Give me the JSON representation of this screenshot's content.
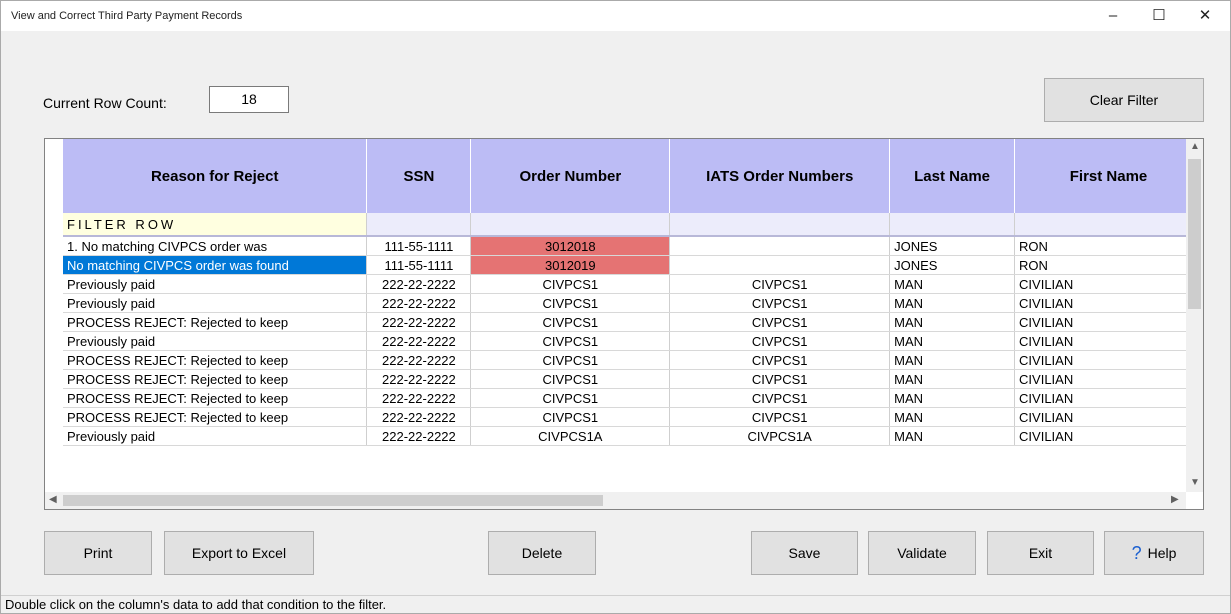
{
  "window": {
    "title": "View and Correct Third Party Payment Records",
    "minimize": "–",
    "maximize": "☐",
    "close": "✕"
  },
  "row_count": {
    "label": "Current Row Count:",
    "value": "18"
  },
  "buttons": {
    "clear_filter": "Clear Filter",
    "print": "Print",
    "export": "Export to Excel",
    "delete": "Delete",
    "save": "Save",
    "validate": "Validate",
    "exit": "Exit",
    "help": "Help"
  },
  "grid": {
    "columns": [
      "Reason for Reject",
      "SSN",
      "Order Number",
      "IATS Order Numbers",
      "Last Name",
      "First Name"
    ],
    "filter_label": "FILTER ROW",
    "rows": [
      [
        "1. No matching CIVPCS order was",
        "111-55-1111",
        "3012018",
        "",
        "JONES",
        "RON"
      ],
      [
        "No matching CIVPCS order was found",
        "111-55-1111",
        "3012019",
        "",
        "JONES",
        "RON"
      ],
      [
        "Previously paid",
        "222-22-2222",
        "CIVPCS1",
        "CIVPCS1",
        "MAN",
        "CIVILIAN"
      ],
      [
        "Previously paid",
        "222-22-2222",
        "CIVPCS1",
        "CIVPCS1",
        "MAN",
        "CIVILIAN"
      ],
      [
        "PROCESS REJECT: Rejected to keep",
        "222-22-2222",
        "CIVPCS1",
        "CIVPCS1",
        "MAN",
        "CIVILIAN"
      ],
      [
        "Previously paid",
        "222-22-2222",
        "CIVPCS1",
        "CIVPCS1",
        "MAN",
        "CIVILIAN"
      ],
      [
        "PROCESS REJECT: Rejected to keep",
        "222-22-2222",
        "CIVPCS1",
        "CIVPCS1",
        "MAN",
        "CIVILIAN"
      ],
      [
        "PROCESS REJECT: Rejected to keep",
        "222-22-2222",
        "CIVPCS1",
        "CIVPCS1",
        "MAN",
        "CIVILIAN"
      ],
      [
        "PROCESS REJECT: Rejected to keep",
        "222-22-2222",
        "CIVPCS1",
        "CIVPCS1",
        "MAN",
        "CIVILIAN"
      ],
      [
        "PROCESS REJECT: Rejected to keep",
        "222-22-2222",
        "CIVPCS1",
        "CIVPCS1",
        "MAN",
        "CIVILIAN"
      ],
      [
        "Previously paid",
        "222-22-2222",
        "CIVPCS1A",
        "CIVPCS1A",
        "MAN",
        "CIVILIAN"
      ]
    ],
    "highlight_color": "#e57373",
    "header_color": "#bcbcf5",
    "selection_color": "#0078d7"
  },
  "status_bar": "Double click on the column's data to add that condition to the filter."
}
